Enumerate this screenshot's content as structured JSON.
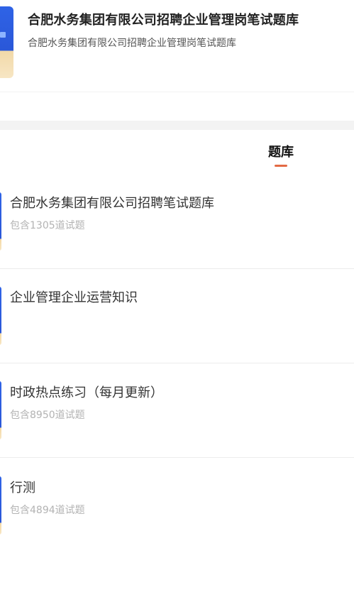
{
  "header": {
    "title": "合肥水务集团有限公司招聘企业管理岗笔试题库",
    "subtitle": "合肥水务集团有限公司招聘企业管理岗笔试题库"
  },
  "tabs": [
    {
      "label": "题库",
      "active": true
    }
  ],
  "items": [
    {
      "title": "合肥水务集团有限公司招聘笔试题库",
      "meta": "包含1305道试题"
    },
    {
      "title": "企业管理企业运营知识",
      "meta": ""
    },
    {
      "title": "时政热点练习（每月更新）",
      "meta": "包含8950道试题"
    },
    {
      "title": "行测",
      "meta": "包含4894道试题"
    }
  ],
  "colors": {
    "accent": "#e36a44",
    "cover_blue": "#2f63e6",
    "cover_sand": "#f7e6c4"
  }
}
